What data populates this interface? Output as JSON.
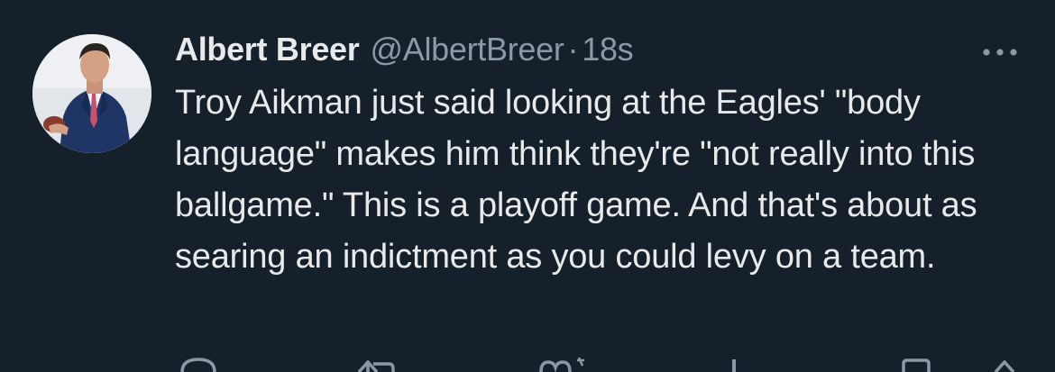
{
  "tweet": {
    "author_name": "Albert Breer",
    "handle": "@AlbertBreer",
    "separator": "·",
    "timestamp": "18s",
    "text": "Troy Aikman just said looking at the Eagles' \"body language\" makes him think they're \"not really into this ballgame.\" This is a playoff game. And that's about as searing an indictment as you could levy on a team."
  },
  "icons": {
    "more": "more-options-icon",
    "reply": "reply-icon",
    "retweet": "retweet-icon",
    "like": "like-icon",
    "views": "views-icon",
    "bookmark": "bookmark-icon",
    "share": "share-icon"
  },
  "colors": {
    "background": "#15202b",
    "primary_text": "#e7e9ea",
    "secondary_text": "#8b98a5"
  }
}
